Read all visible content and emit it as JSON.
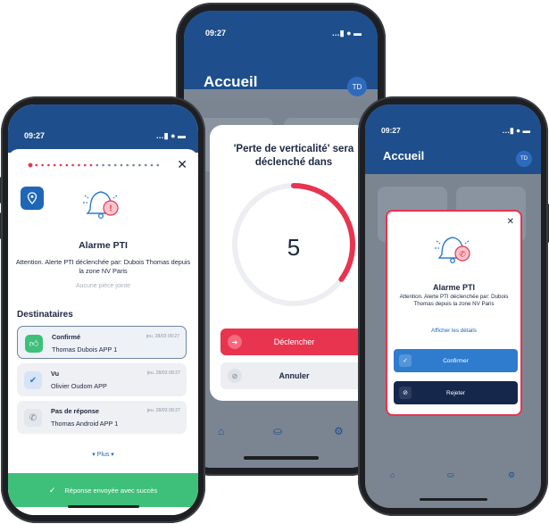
{
  "center_phone": {
    "status_time": "09:27",
    "status_icons": "…▮ ● ▬",
    "title": "Accueil",
    "avatar": "TD",
    "modal_title": "'Perte de verticalité' sera déclenché dans",
    "countdown": "5",
    "countdown_fraction": 0.35,
    "trigger_label": "Déclencher",
    "cancel_label": "Annuler"
  },
  "left_phone": {
    "status_time": "09:27",
    "status_icons": "…▮ ● ▬",
    "close": "✕",
    "alarm_title": "Alarme PTI",
    "alarm_desc": "Attention. Alerte PTI déclenchée par: Dubois Thomas depuis la zone NV Paris",
    "attachment": "Aucune pièce jointe",
    "recipients_title": "Destinataires",
    "recipients": [
      {
        "status": "Confirmé",
        "name": "Thomas Dubois APP 1",
        "date": "jeu. 28/03 09:27"
      },
      {
        "status": "Vu",
        "name": "Olivier Oudom APP",
        "date": "jeu. 28/03 09:27"
      },
      {
        "status": "Pas de réponse",
        "name": "Thomas Android APP 1",
        "date": "jeu. 28/03 09:27"
      }
    ],
    "more": "▾  Plus  ▾",
    "toast": "Réponse envoyée avec succès"
  },
  "right_phone": {
    "status_time": "09:27",
    "status_icons": "…▮ ● ▬",
    "title": "Accueil",
    "avatar": "TD",
    "close": "✕",
    "alarm_title": "Alarme PTI",
    "alarm_desc": "Attention. Alerte PTI déclenchée par: Dubois Thomas depuis la zone NV Paris",
    "details_link": "Afficher les détails",
    "confirm_label": "Confirmer",
    "reject_label": "Rejeter"
  },
  "colors": {
    "brand_blue": "#1e4f8c",
    "alert_red": "#e8344f",
    "success_green": "#3ec07a",
    "confirm_blue": "#2f7ccf",
    "reject_navy": "#15284b"
  },
  "icons": [
    "pin-icon",
    "bell-alert-icon",
    "thumbs-up-icon",
    "double-check-icon",
    "phone-icon",
    "home-icon",
    "inbox-icon",
    "settings-icon",
    "check-icon",
    "ban-icon",
    "close-icon"
  ]
}
